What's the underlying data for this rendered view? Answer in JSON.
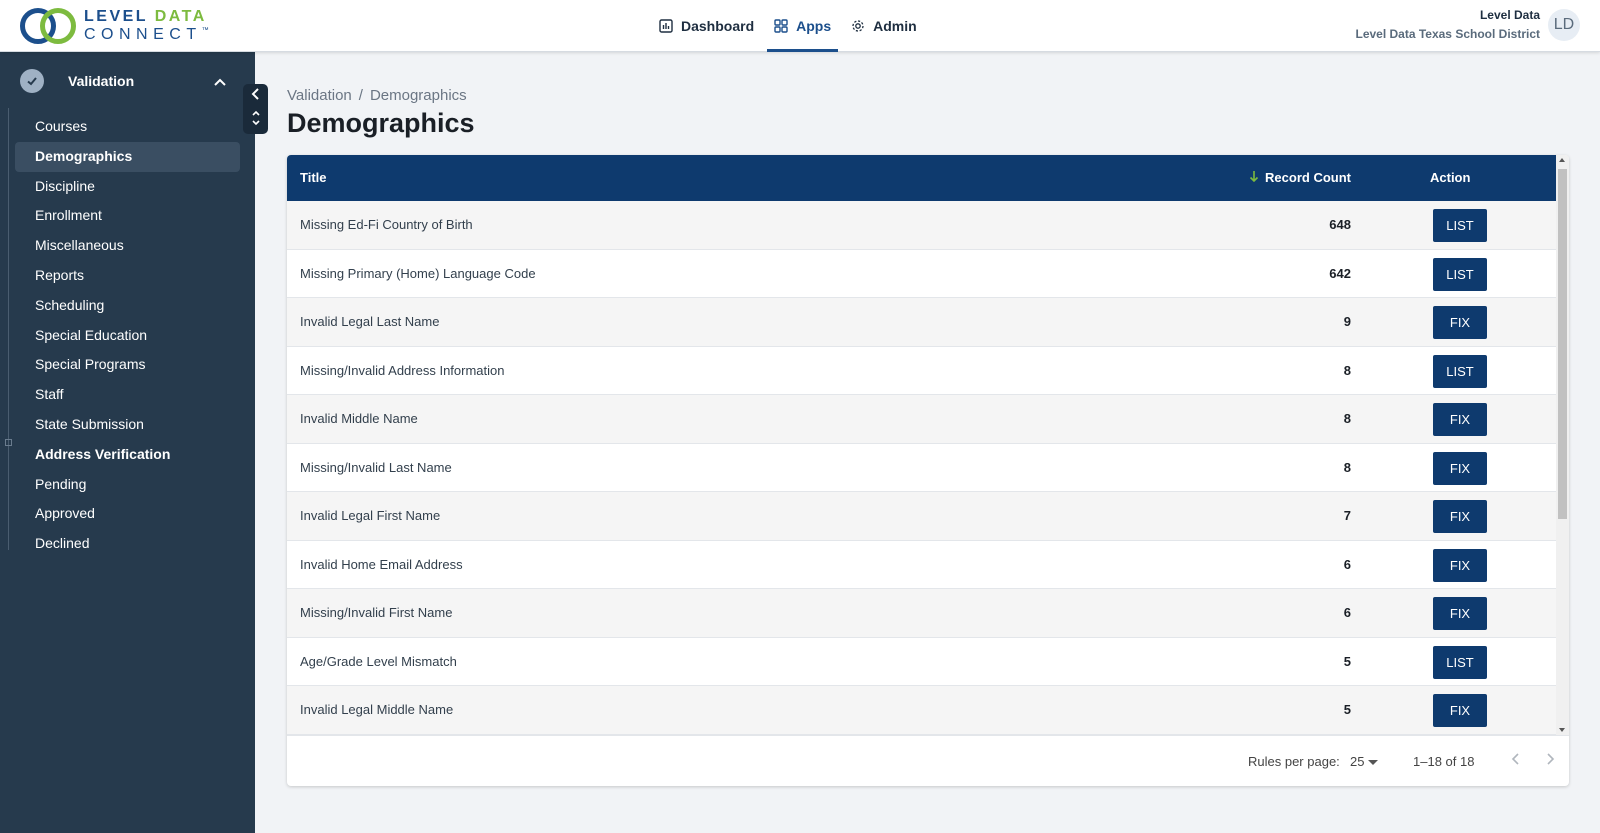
{
  "brand": {
    "line1_a": "LEVEL ",
    "line1_b": "DATA",
    "line2": "CONNECT",
    "tm": "™"
  },
  "topnav": {
    "items": [
      {
        "label": "Dashboard",
        "icon": "chart-icon"
      },
      {
        "label": "Apps",
        "icon": "apps-grid-icon"
      },
      {
        "label": "Admin",
        "icon": "gear-icon"
      }
    ],
    "active": "Apps"
  },
  "user": {
    "name": "Level Data",
    "org": "Level Data Texas School District",
    "initials": "LD"
  },
  "sidebar": {
    "section_label": "Validation",
    "items": [
      {
        "label": "Courses"
      },
      {
        "label": "Demographics"
      },
      {
        "label": "Discipline"
      },
      {
        "label": "Enrollment"
      },
      {
        "label": "Miscellaneous"
      },
      {
        "label": "Reports"
      },
      {
        "label": "Scheduling"
      },
      {
        "label": "Special Education"
      },
      {
        "label": "Special Programs"
      },
      {
        "label": "Staff"
      },
      {
        "label": "State Submission"
      },
      {
        "label": "Address Verification"
      },
      {
        "label": "Pending"
      },
      {
        "label": "Approved"
      },
      {
        "label": "Declined"
      }
    ],
    "active": "Demographics"
  },
  "breadcrumb": {
    "parent": "Validation",
    "separator": "/",
    "current": "Demographics"
  },
  "page": {
    "title": "Demographics"
  },
  "table": {
    "headers": {
      "title": "Title",
      "count": "Record Count",
      "action": "Action"
    },
    "rows": [
      {
        "title": "Missing Ed-Fi Country of Birth",
        "count": "648",
        "action": "LIST"
      },
      {
        "title": "Missing Primary (Home) Language Code",
        "count": "642",
        "action": "LIST"
      },
      {
        "title": "Invalid Legal Last Name",
        "count": "9",
        "action": "FIX"
      },
      {
        "title": "Missing/Invalid Address Information",
        "count": "8",
        "action": "LIST"
      },
      {
        "title": "Invalid Middle Name",
        "count": "8",
        "action": "FIX"
      },
      {
        "title": "Missing/Invalid Last Name",
        "count": "8",
        "action": "FIX"
      },
      {
        "title": "Invalid Legal First Name",
        "count": "7",
        "action": "FIX"
      },
      {
        "title": "Invalid Home Email Address",
        "count": "6",
        "action": "FIX"
      },
      {
        "title": "Missing/Invalid First Name",
        "count": "6",
        "action": "FIX"
      },
      {
        "title": "Age/Grade Level Mismatch",
        "count": "5",
        "action": "LIST"
      },
      {
        "title": "Invalid Legal Middle Name",
        "count": "5",
        "action": "FIX"
      }
    ]
  },
  "pagination": {
    "rows_label": "Rules per page:",
    "per_page": "25",
    "range": "1–18 of 18"
  },
  "colors": {
    "header_blue": "#0e3a6e",
    "sidebar_bg": "#263a4d",
    "brand_green": "#7dbb3f",
    "brand_blue": "#1c4f8c"
  }
}
